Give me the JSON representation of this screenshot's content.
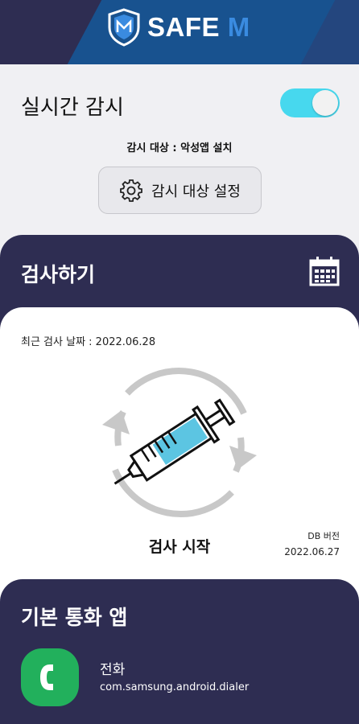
{
  "header": {
    "brand_prefix": "SAFE",
    "brand_suffix": "M",
    "logo_icon": "shield-icon"
  },
  "monitor": {
    "title": "실시간 감시",
    "toggle_on": true,
    "target_text": "감시 대상 : 악성앱 설치",
    "settings_button": "감시 대상 설정",
    "settings_icon": "gear-icon"
  },
  "scan": {
    "title": "검사하기",
    "calendar_icon": "calendar-icon",
    "last_scan": "최근 검사 날짜 : 2022.06.28",
    "start_label": "검사 시작",
    "db_label": "DB 버전",
    "db_date": "2022.06.27",
    "graphic_icon": "syringe-refresh-icon"
  },
  "dialer": {
    "title": "기본 통화 앱",
    "app_name": "전화",
    "app_package": "com.samsung.android.dialer",
    "app_icon": "phone-icon"
  },
  "colors": {
    "header_bg": "#2e2d52",
    "header_accent": "#18528f",
    "toggle_on": "#47d8ee",
    "dialer_icon_bg": "#22b05c"
  }
}
